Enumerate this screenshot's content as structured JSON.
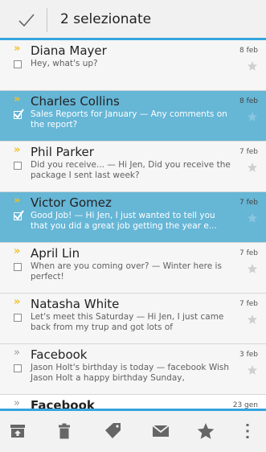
{
  "topbar": {
    "selected_count": "2 selezionate"
  },
  "emails": [
    {
      "sender": "Diana Mayer",
      "date": "8 feb",
      "preview": "Hey, what's up?",
      "selected": false,
      "important": true,
      "unread": false
    },
    {
      "sender": "Charles Collins",
      "date": "8 feb",
      "preview": "Sales Reports for January — Any comments on the report?",
      "selected": true,
      "important": true,
      "unread": false
    },
    {
      "sender": "Phil Parker",
      "date": "7 feb",
      "preview": "Did you receive... — Hi Jen, Did you receive the package I sent last week?",
      "selected": false,
      "important": true,
      "unread": false
    },
    {
      "sender": "Victor Gomez",
      "date": "7 feb",
      "preview": "Good Job! — Hi Jen, I just wanted to tell you that you did a great job getting the year e...",
      "selected": true,
      "important": true,
      "unread": false
    },
    {
      "sender": "April Lin",
      "date": "7 feb",
      "preview": "When are you coming over? — Winter here is perfect!",
      "selected": false,
      "important": true,
      "unread": false
    },
    {
      "sender": "Natasha White",
      "date": "7 feb",
      "preview": "Let's meet this Saturday — Hi Jen, I just came back from my trup and got lots of",
      "selected": false,
      "important": true,
      "unread": false
    },
    {
      "sender": "Facebook",
      "date": "3 feb",
      "preview": "Jason Holt's birthday is today — facebook Wish Jason Holt a happy birthday Sunday,",
      "selected": false,
      "important": false,
      "unread": false
    },
    {
      "sender": "Facebook",
      "date": "23 gen",
      "preview": "",
      "selected": false,
      "important": false,
      "unread": true
    }
  ],
  "toolbar": {
    "icons": [
      "archive-icon",
      "trash-icon",
      "label-icon",
      "mark-unread-icon",
      "star-icon",
      "overflow-menu-icon"
    ]
  },
  "colors": {
    "accent": "#34a5de",
    "selected_row": "#66b6d6",
    "important": "#f0c12c",
    "icon": "#666666"
  }
}
